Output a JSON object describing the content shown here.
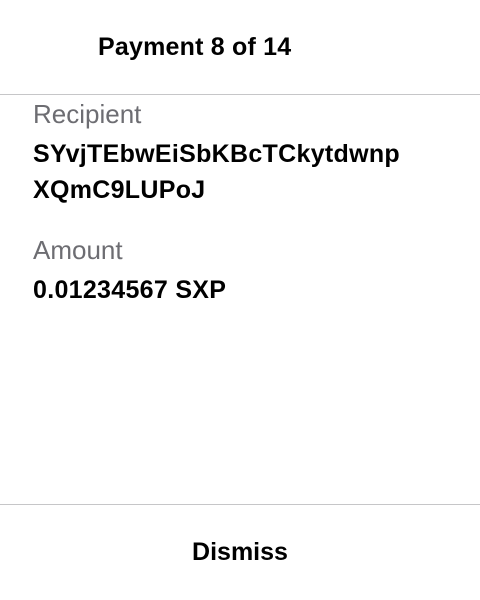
{
  "header": {
    "title": "Payment 8 of 14"
  },
  "recipient": {
    "label": "Recipient",
    "address_line1": "SYvjTEbwEiSbKBcTCkytdwnp",
    "address_line2": "XQmC9LUPoJ"
  },
  "amount": {
    "label": "Amount",
    "value": "0.01234567 SXP"
  },
  "footer": {
    "dismiss_label": "Dismiss"
  }
}
